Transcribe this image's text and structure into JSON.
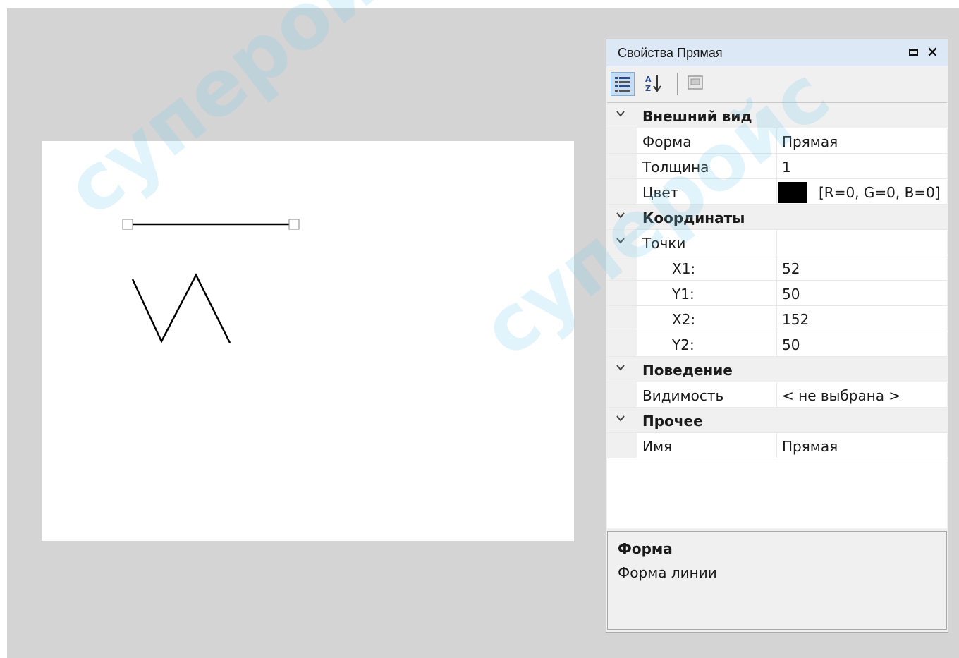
{
  "panel": {
    "title": "Свойства Прямая",
    "toolbar": {
      "categorized_icon": "categorized-icon",
      "alphabetical_icon": "alphabetical-sort-icon",
      "property_pages_icon": "property-pages-icon"
    }
  },
  "properties": {
    "appearance": {
      "label": "Внешний вид"
    },
    "shape": {
      "name": "Форма",
      "value": "Прямая"
    },
    "thickness": {
      "name": "Толщина",
      "value": "1"
    },
    "color": {
      "name": "Цвет",
      "value": "[R=0, G=0, B=0]",
      "swatch": "#000000"
    },
    "coordinates": {
      "label": "Координаты"
    },
    "points": {
      "name": "Точки"
    },
    "x1": {
      "name": "X1:",
      "value": "52"
    },
    "y1": {
      "name": "Y1:",
      "value": "50"
    },
    "x2": {
      "name": "X2:",
      "value": "152"
    },
    "y2": {
      "name": "Y2:",
      "value": "50"
    },
    "behavior": {
      "label": "Поведение"
    },
    "visibility": {
      "name": "Видимость",
      "value": "< не выбрана >"
    },
    "other": {
      "label": "Прочее"
    },
    "name_prop": {
      "name": "Имя",
      "value": "Прямая"
    }
  },
  "description": {
    "title": "Форма",
    "text": "Форма линии"
  },
  "watermark": {
    "text_a": "суперойс",
    "text_b": "суперойс"
  },
  "colors": {
    "workspace": "#d4d4d4",
    "title_bar": "#dce8f5",
    "selected_tool": "#c5dcf3",
    "line": "#000000"
  }
}
